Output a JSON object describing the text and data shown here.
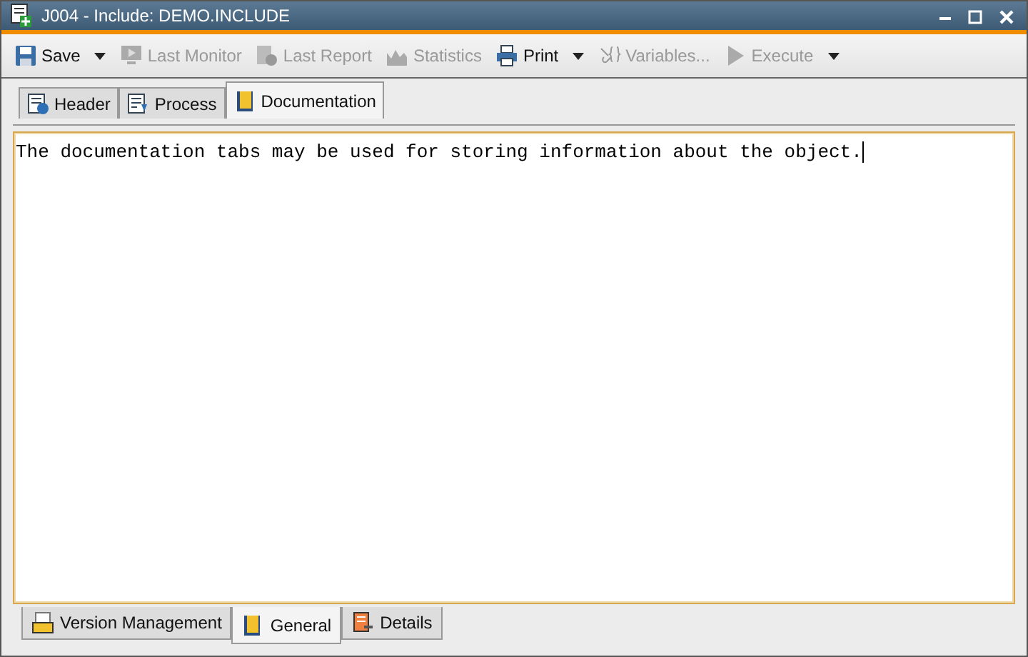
{
  "window": {
    "title": "J004 - Include: DEMO.INCLUDE"
  },
  "toolbar": [
    {
      "kind": "save",
      "label": "Save",
      "disabled": false,
      "dropdown": true
    },
    {
      "kind": "monitor",
      "label": "Last Monitor",
      "disabled": true,
      "dropdown": false
    },
    {
      "kind": "report",
      "label": "Last Report",
      "disabled": true,
      "dropdown": false
    },
    {
      "kind": "statistics",
      "label": "Statistics",
      "disabled": true,
      "dropdown": false
    },
    {
      "kind": "print",
      "label": "Print",
      "disabled": false,
      "dropdown": true
    },
    {
      "kind": "variables",
      "label": "Variables...",
      "disabled": true,
      "dropdown": false
    },
    {
      "kind": "execute",
      "label": "Execute",
      "disabled": true,
      "dropdown": true
    }
  ],
  "tabs": [
    {
      "kind": "header",
      "label": "Header",
      "selected": false
    },
    {
      "kind": "process",
      "label": "Process",
      "selected": false
    },
    {
      "kind": "doc",
      "label": "Documentation",
      "selected": true
    }
  ],
  "editor": {
    "text": "The documentation tabs may be used for storing information about the object."
  },
  "bottom_tabs": [
    {
      "kind": "ucs",
      "label": "Version Management",
      "selected": false
    },
    {
      "kind": "doc",
      "label": "General",
      "selected": true
    },
    {
      "kind": "details",
      "label": "Details",
      "selected": false
    }
  ]
}
